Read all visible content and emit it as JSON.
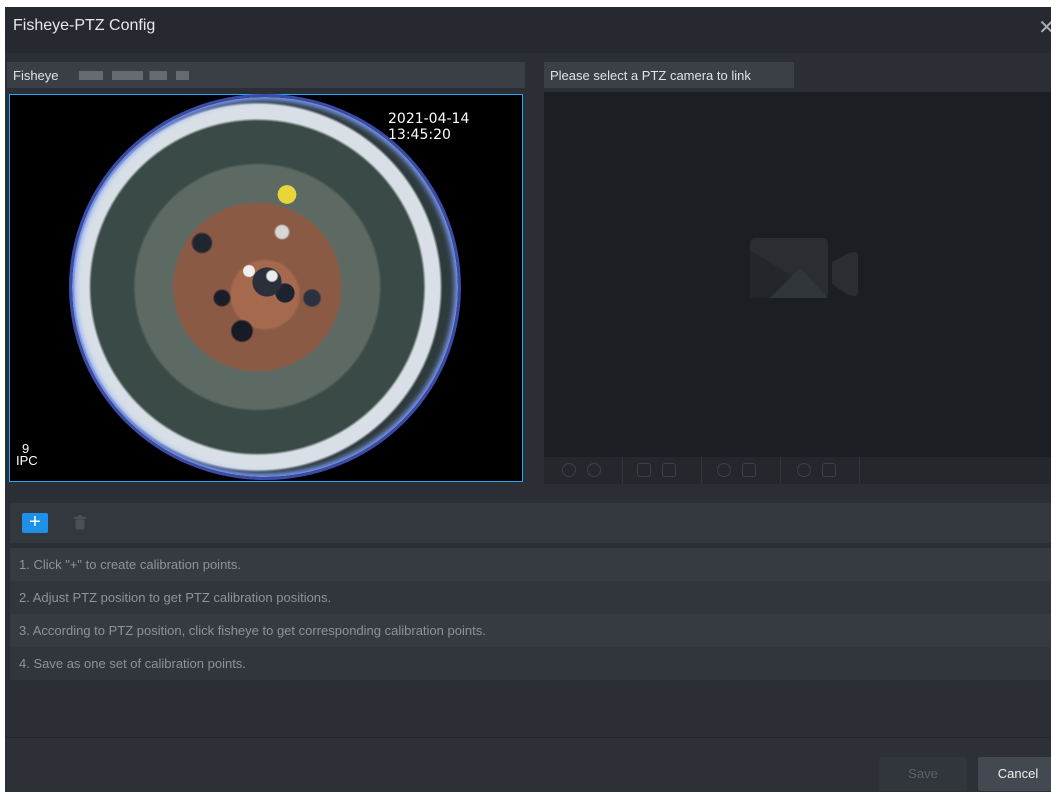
{
  "dialog": {
    "title": "Fisheye-PTZ Config",
    "close_glyph": "✕"
  },
  "fisheye_panel": {
    "label": "Fisheye",
    "timestamp": "2021-04-14 13:45:20",
    "overlay_number": "9",
    "overlay_text": "IPC"
  },
  "ptz_panel": {
    "label": "Please select a PTZ camera to link",
    "placeholder_icon": "camera-off-icon",
    "toolbar_icons": [
      "zoom-out-icon",
      "zoom-in-icon",
      "focus-near-icon",
      "focus-far-icon",
      "iris-close-icon",
      "iris-open-icon",
      "hand-icon",
      "preset-icon"
    ]
  },
  "calibration": {
    "add_label": "+",
    "delete_icon": "trash-icon",
    "instructions": [
      "1. Click \"+\" to create calibration points.",
      "2. Adjust PTZ position to get PTZ calibration positions.",
      "3. According to PTZ position, click fisheye to get corresponding calibration points.",
      "4. Save as one set of calibration points."
    ]
  },
  "footer": {
    "save_label": "Save",
    "cancel_label": "Cancel"
  },
  "colors": {
    "accent": "#1e90e8",
    "selection_border": "#2aa6ff",
    "background": "#2b2f35"
  }
}
